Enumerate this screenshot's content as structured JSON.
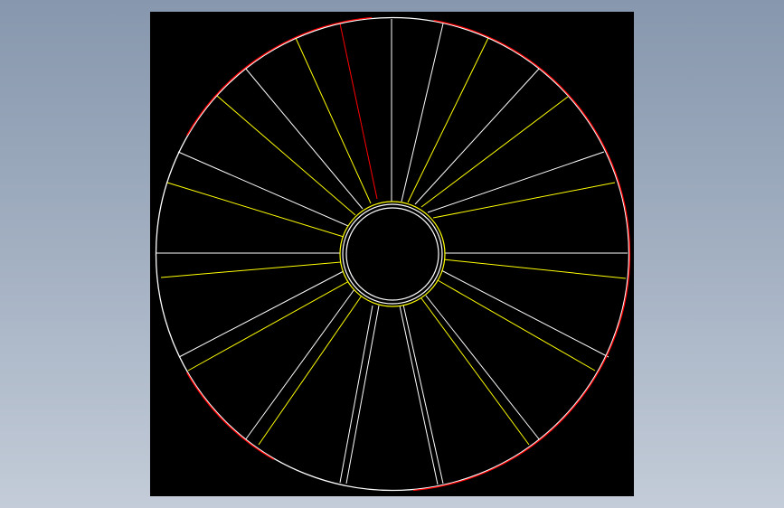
{
  "viewport": {
    "background": "#000000",
    "page_background": [
      "#8797ad",
      "#c3ccd8"
    ]
  },
  "wheel": {
    "colors": {
      "white": "#ffffff",
      "yellow": "#ffff00",
      "red": "#ff0000"
    },
    "blade_count": 27
  }
}
